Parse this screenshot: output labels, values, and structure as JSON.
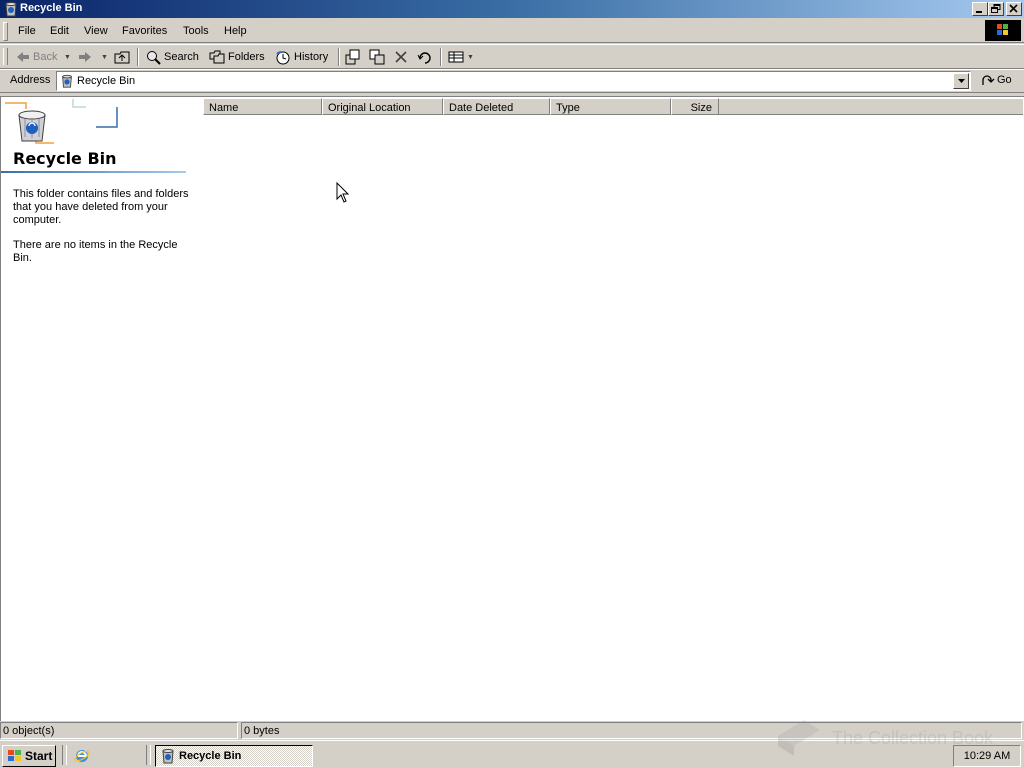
{
  "window": {
    "title": "Recycle Bin",
    "icons": {
      "app": "recycle-bin-icon",
      "minimize": "minimize-icon",
      "restore": "restore-icon",
      "close": "close-icon"
    }
  },
  "menu": {
    "items": [
      "File",
      "Edit",
      "View",
      "Favorites",
      "Tools",
      "Help"
    ]
  },
  "toolbar": {
    "back_label": "Back",
    "search_label": "Search",
    "folders_label": "Folders",
    "history_label": "History"
  },
  "address": {
    "label": "Address",
    "value": "Recycle Bin",
    "go_label": "Go"
  },
  "left_pane": {
    "title": "Recycle Bin",
    "description": "This folder contains files and folders that you have deleted from your computer.",
    "empty_message": "There are no items in the Recycle Bin."
  },
  "list": {
    "columns": [
      "Name",
      "Original Location",
      "Date Deleted",
      "Type",
      "Size"
    ],
    "rows": []
  },
  "status": {
    "objects": "0 object(s)",
    "size": "0 bytes"
  },
  "taskbar": {
    "start_label": "Start",
    "task_label": "Recycle Bin",
    "clock": "10:29 AM"
  },
  "watermark": "The Collection Book",
  "colors": {
    "title_gradient_start": "#0a246a",
    "title_gradient_end": "#a6caf0",
    "chrome": "#d4d0c8",
    "accent_rule": "#3a6ea5"
  }
}
